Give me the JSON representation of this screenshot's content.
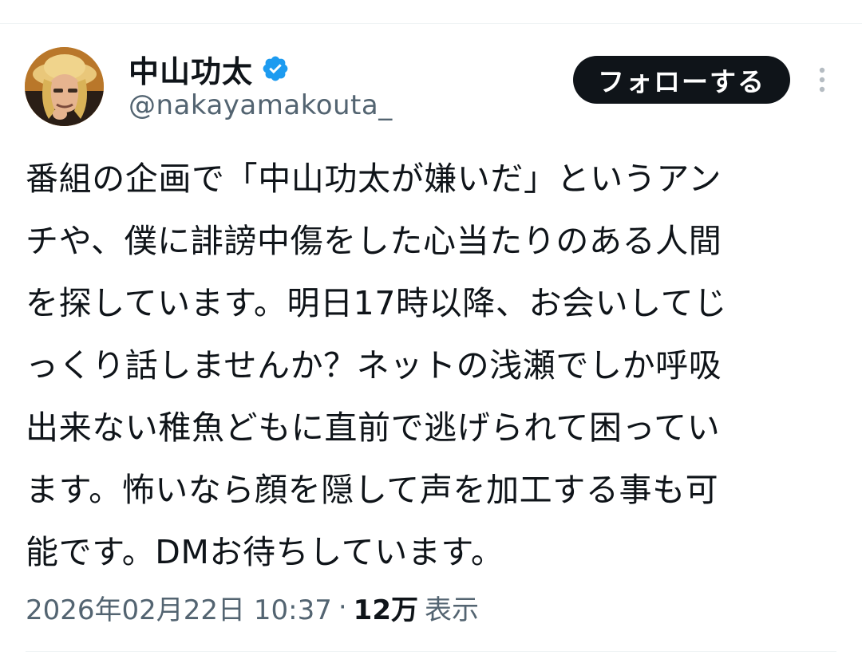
{
  "author": {
    "display_name": "中山功太",
    "handle": "@nakayamakouta_",
    "verified_badge_color": "#1d9bf0",
    "avatar_icon": "user-avatar-photo"
  },
  "actions": {
    "follow_label": "フォローする",
    "more_icon": "more-vertical-icon"
  },
  "tweet": {
    "text_lines": [
      "番組の企画で「中山功太が嫌いだ」というアン",
      "チや、僕に誹謗中傷をした心当たりのある人間",
      "を探しています。明日17時以降、お会いしてじ",
      "っくり話しませんか？ネットの浅瀬でしか呼吸",
      "出来ない稚魚どもに直前で逃げられて困ってい",
      "ます。怖いなら顔を隠して声を加工する事も可",
      "能です。DMお待ちしています。"
    ]
  },
  "meta": {
    "timestamp": "2026年02月22日 10:37",
    "separator": "·",
    "views_count": "12万",
    "views_label": "表示"
  },
  "colors": {
    "text_primary": "#0f1419",
    "text_secondary": "#536471",
    "button_bg": "#0f1419",
    "divider": "#eff3f4"
  }
}
